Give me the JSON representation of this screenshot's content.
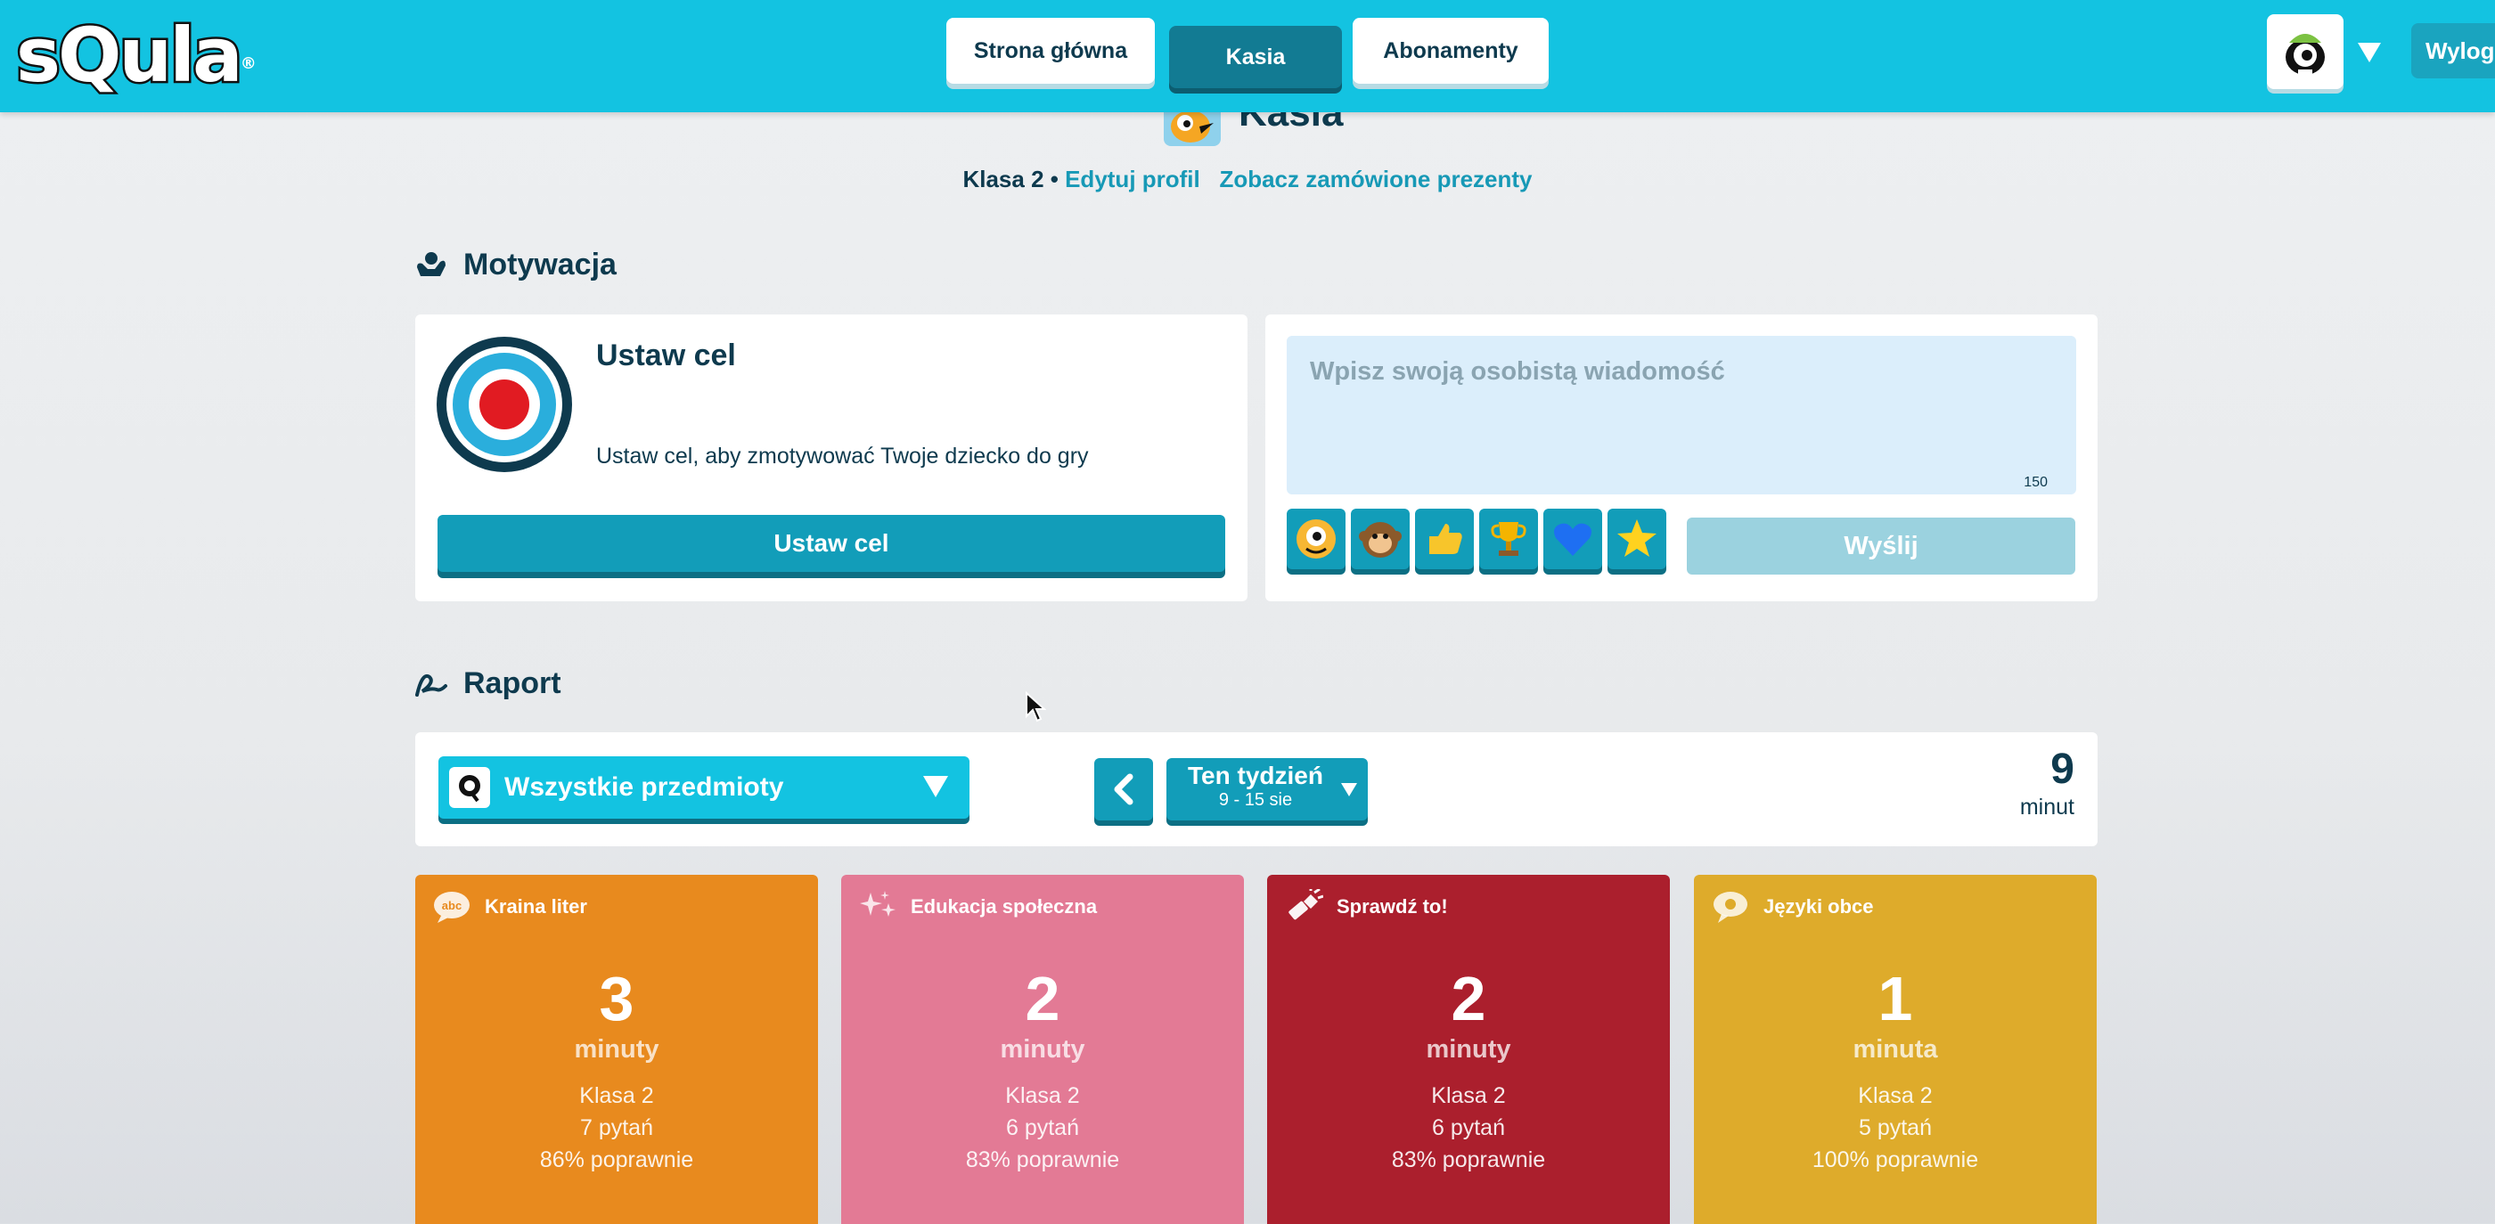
{
  "header": {
    "logo_text": "sQula",
    "logo_mark": "®",
    "nav": [
      "Strona główna",
      "Kasia",
      "Abonamenty"
    ],
    "active_nav": "Kasia",
    "logout_label": "Wylogu"
  },
  "profile": {
    "name": "Kasia",
    "grade": "Klasa 2 •",
    "edit_link": "Edytuj profil",
    "gifts_link": "Zobacz zamówione prezenty"
  },
  "motivation": {
    "title": "Motywacja",
    "goal_title": "Ustaw cel",
    "goal_desc": "Ustaw cel, aby zmotywować Twoje dziecko do gry",
    "goal_button": "Ustaw cel",
    "message_placeholder": "Wpisz swoją osobistą wiadomość",
    "message_limit": "150",
    "emojis": [
      "monster-face-icon",
      "monkey-face-icon",
      "thumbs-up-icon",
      "trophy-icon",
      "heart-icon",
      "star-icon"
    ],
    "send_button": "Wyślij"
  },
  "report": {
    "title": "Raport",
    "subject_filter": "Wszystkie przedmioty",
    "week_label": "Ten tydzień",
    "week_range": "9 - 15 sie",
    "total_value": "9",
    "total_unit": "minut",
    "subjects": [
      {
        "name": "Kraina liter",
        "icon": "abc-bubble-icon",
        "value": "3",
        "unit": "minuty",
        "grade": "Klasa 2",
        "questions": "7 pytań",
        "correct": "86% poprawnie",
        "color": "#e88a1e"
      },
      {
        "name": "Edukacja społeczna",
        "icon": "sparkles-icon",
        "value": "2",
        "unit": "minuty",
        "grade": "Klasa 2",
        "questions": "6 pytań",
        "correct": "83% poprawnie",
        "color": "#e37a95"
      },
      {
        "name": "Sprawdź to!",
        "icon": "flashlight-icon",
        "value": "2",
        "unit": "minuty",
        "grade": "Klasa 2",
        "questions": "6 pytań",
        "correct": "83% poprawnie",
        "color": "#ab1f2d"
      },
      {
        "name": "Języki obce",
        "icon": "speech-bubble-icon",
        "value": "1",
        "unit": "minuta",
        "grade": "Klasa 2",
        "questions": "5 pytań",
        "correct": "100% poprawnie",
        "color": "#deab2b"
      }
    ]
  }
}
